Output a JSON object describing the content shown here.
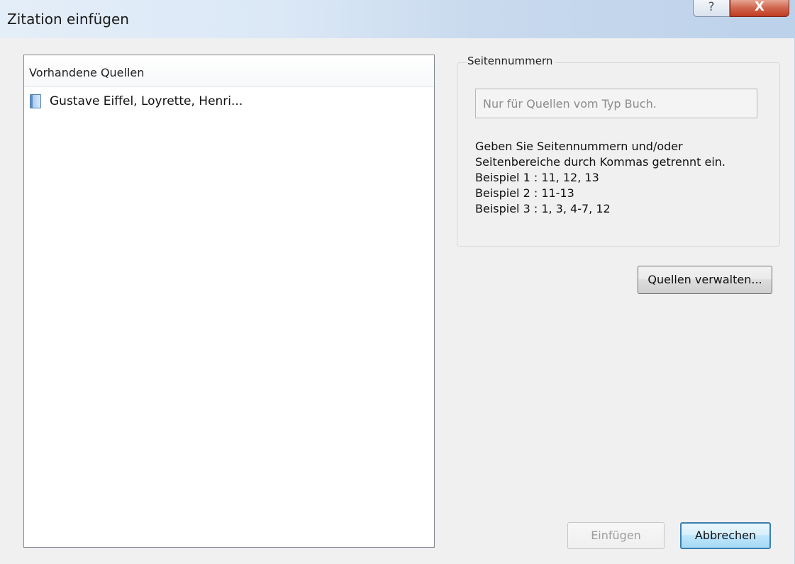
{
  "window": {
    "title": "Zitation einfügen",
    "help_icon": "?",
    "close_icon": "X"
  },
  "sources": {
    "header": "Vorhandene Quellen",
    "items": [
      {
        "label": "Gustave Eiffel, Loyrette, Henri...",
        "icon": "book-icon"
      }
    ]
  },
  "page_numbers": {
    "group_label": "Seitennummern",
    "placeholder": "Nur für Quellen vom Typ Buch.",
    "value": "",
    "help_lines": [
      "Geben Sie Seitennummern und/oder",
      "Seitenbereiche durch Kommas getrennt ein.",
      "Beispiel 1 : 11, 12, 13",
      "Beispiel 2 : 11-13",
      "Beispiel 3 : 1, 3, 4-7, 12"
    ]
  },
  "buttons": {
    "manage_sources": "Quellen verwalten...",
    "insert": "Einfügen",
    "insert_enabled": false,
    "cancel": "Abbrechen"
  },
  "colors": {
    "titlebar": "#c9daee",
    "close_button": "#c94a2f",
    "default_button_border": "#3c7fb1"
  }
}
